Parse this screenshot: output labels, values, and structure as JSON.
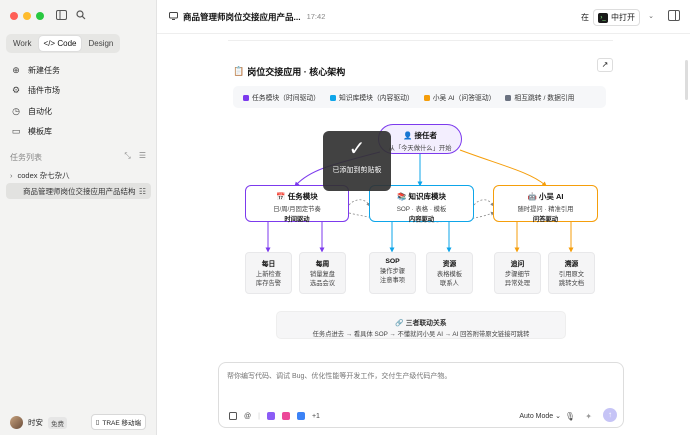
{
  "sidebar": {
    "mode_tabs": [
      "Work",
      "Code",
      "Design"
    ],
    "code_tab_icon": "</>",
    "nav": [
      {
        "label": "新建任务",
        "icon": "plus-circle-icon"
      },
      {
        "label": "插件市场",
        "icon": "plugin-icon"
      },
      {
        "label": "自动化",
        "icon": "clock-icon"
      },
      {
        "label": "模板库",
        "icon": "folder-icon"
      }
    ],
    "section_title": "任务列表",
    "tasks": [
      {
        "label": "codex 杂七杂八",
        "active": false
      },
      {
        "label": "商品管理师岗位交接应用产品结构",
        "active": true
      }
    ],
    "user": {
      "name": "时安",
      "plan": "免费"
    },
    "mobile_button": "TRAE 移动端"
  },
  "header": {
    "title": "商品管理师岗位交接应用产品...",
    "time": "17:42",
    "open_prefix": "在",
    "open_label": "中打开"
  },
  "diagram": {
    "title": "岗位交接应用 · 核心架构",
    "legend": [
      {
        "label": "任务模块（时间驱动）",
        "color": "#7c3aed"
      },
      {
        "label": "知识库模块（内容驱动）",
        "color": "#0ea5e9"
      },
      {
        "label": "小吴 AI（问答驱动）",
        "color": "#f59e0b"
      },
      {
        "label": "相互跳转 / 数据引用",
        "color": "#6b7280"
      }
    ],
    "root": {
      "title": "接任者",
      "sub": "从「今天做什么」开始"
    },
    "modules": [
      {
        "title": "任务模块",
        "sub": "日/周/月固定节奏",
        "drive": "时间驱动",
        "color": "#7c3aed"
      },
      {
        "title": "知识库模块",
        "sub": "SOP · 表格 · 模板",
        "drive": "内容驱动",
        "color": "#0ea5e9"
      },
      {
        "title": "小吴 AI",
        "sub": "随时提问 · 精准引用",
        "drive": "问答驱动",
        "color": "#f59e0b"
      }
    ],
    "leaves": [
      {
        "title": "每日",
        "lines": [
          "上新检查",
          "库存告警"
        ]
      },
      {
        "title": "每周",
        "lines": [
          "销量复盘",
          "选品会议"
        ]
      },
      {
        "title": "SOP",
        "lines": [
          "操作步骤",
          "注意事项"
        ]
      },
      {
        "title": "资源",
        "lines": [
          "表格模板",
          "联系人"
        ]
      },
      {
        "title": "追问",
        "lines": [
          "步骤细节",
          "异常处理"
        ]
      },
      {
        "title": "溯源",
        "lines": [
          "引用原文",
          "跳转文档"
        ]
      }
    ],
    "linkage": {
      "title": "🔗 三者联动关系",
      "desc": "任务点进去 → 看具体 SOP → 不懂就问小吴 AI → AI 回答附带原文链接可跳转"
    }
  },
  "toast": {
    "message": "已添加到剪贴板"
  },
  "input": {
    "placeholder": "帮你编写代码、调试 Bug、优化性能等开发工作，交付生产级代码产物。",
    "extra_count": "+1",
    "mode": "Auto Mode"
  }
}
